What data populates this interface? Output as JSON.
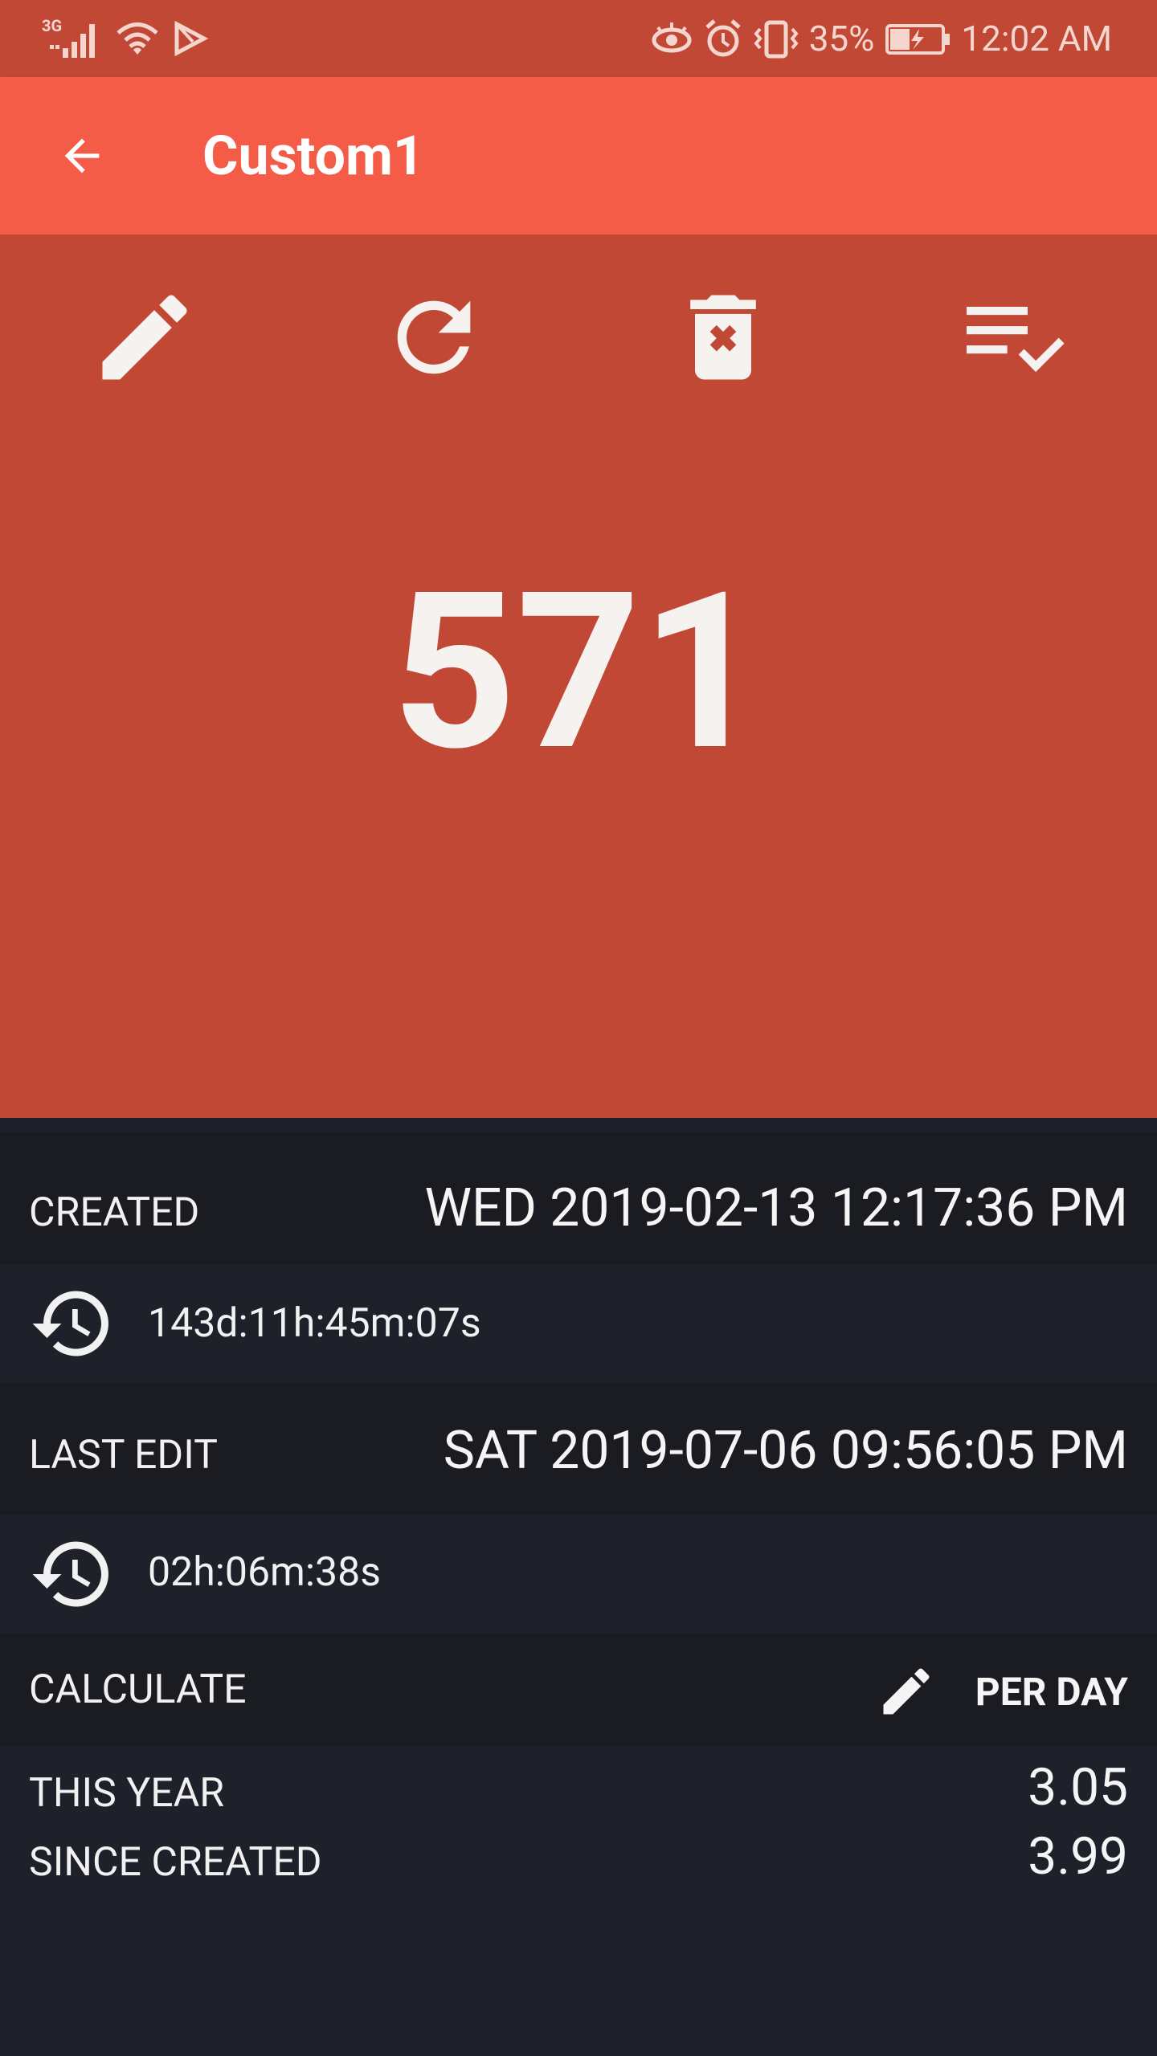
{
  "status_bar": {
    "network_label": "3G",
    "battery_percent": "35%",
    "time": "12:02 AM"
  },
  "app_bar": {
    "title": "Custom1"
  },
  "counter": {
    "value": "571",
    "decrement_label": "-",
    "increment_label": "+"
  },
  "created": {
    "label": "CREATED",
    "datetime": "WED 2019-02-13 12:17:36 PM",
    "elapsed": "143d:11h:45m:07s"
  },
  "last_edit": {
    "label": "LAST EDIT",
    "datetime": "SAT 2019-07-06 09:56:05 PM",
    "elapsed": "02h:06m:38s"
  },
  "calculate": {
    "label": "CALCULATE",
    "mode": "PER DAY"
  },
  "stats": [
    {
      "label": "THIS YEAR",
      "value": "3.05"
    },
    {
      "label": "SINCE CREATED",
      "value": "3.99"
    }
  ],
  "colors": {
    "status_bar": "#c24836",
    "app_bar": "#f55c47",
    "counter_panel": "#c24836",
    "background": "#1e2029"
  }
}
